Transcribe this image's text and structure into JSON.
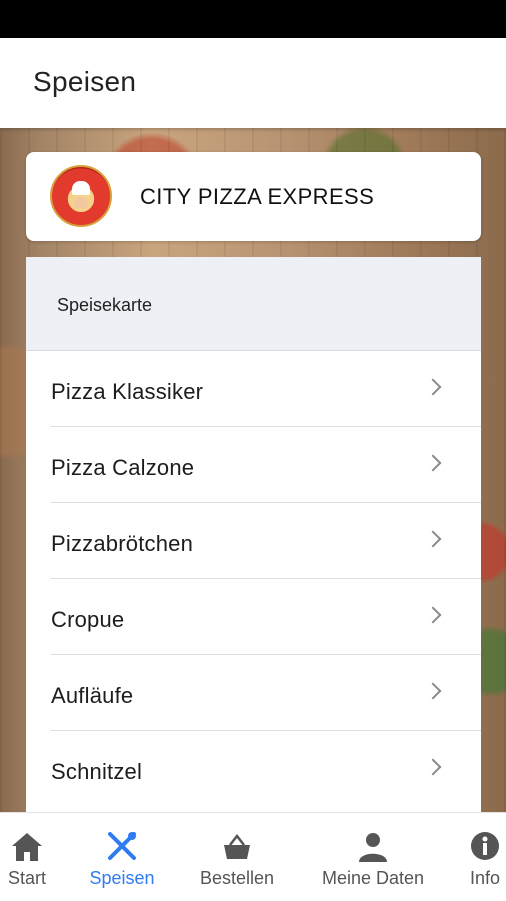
{
  "app_bar": {
    "title": "Speisen"
  },
  "brand": {
    "name": "CITY PIZZA EXPRESS",
    "logo_icon": "pizza-chef-logo"
  },
  "menu": {
    "header": "Speisekarte",
    "items": [
      {
        "label": "Pizza Klassiker"
      },
      {
        "label": "Pizza Calzone"
      },
      {
        "label": "Pizzabrötchen"
      },
      {
        "label": "Cropue"
      },
      {
        "label": "Aufläufe"
      },
      {
        "label": "Schnitzel"
      }
    ]
  },
  "bottom_nav": {
    "active_color": "#2f7bf2",
    "items": [
      {
        "label": "Start",
        "icon": "home-icon"
      },
      {
        "label": "Speisen",
        "icon": "cutlery-icon",
        "active": true
      },
      {
        "label": "Bestellen",
        "icon": "basket-icon"
      },
      {
        "label": "Meine Daten",
        "icon": "person-icon"
      },
      {
        "label": "Info",
        "icon": "info-icon"
      }
    ]
  }
}
